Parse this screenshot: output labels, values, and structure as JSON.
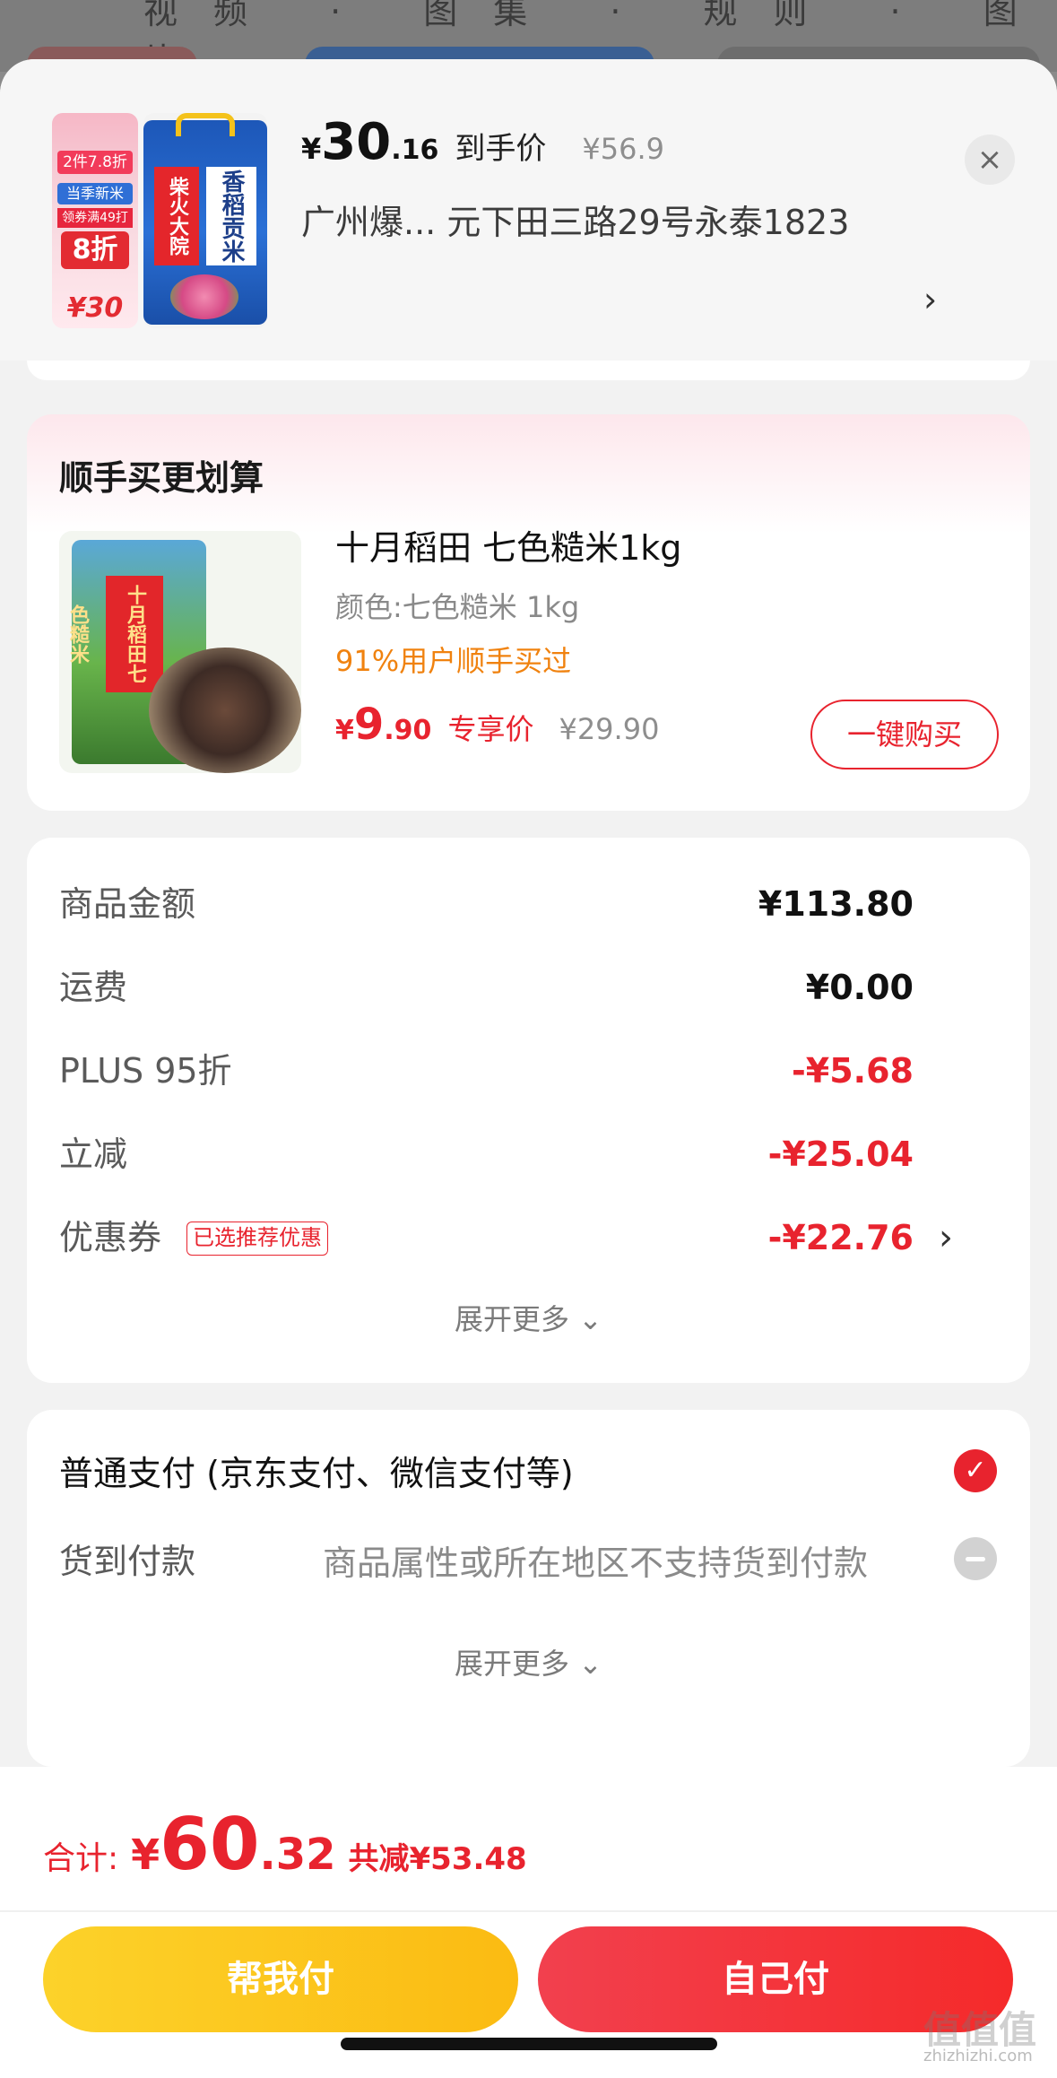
{
  "background": {
    "tabs": "视频 · 图集 · 规则 · 图片"
  },
  "header": {
    "price_yen": "¥",
    "price_int": "30",
    "price_dec": ".16",
    "price_tag": "到手价",
    "original_price": "¥56.9",
    "address": "广州爆... 元下田三路29号永泰1823",
    "arrow": "›",
    "close": "×",
    "thumb1": {
      "badge1": "2件7.8折",
      "badge2": "当季新米",
      "badge3": "领券满49打",
      "badge4": "8折",
      "price": "¥30"
    },
    "thumb2": {
      "red_label": "柴火大院",
      "white_label": "香稻贡米"
    }
  },
  "upsell": {
    "title": "顺手买更划算",
    "product_image_label": "十月稻田七色糙米",
    "name": "十月稻田 七色糙米1kg",
    "spec": "颜色:七色糙米 1kg",
    "buyers": "91%用户顺手买过",
    "price_yen": "¥",
    "price_int": "9",
    "price_dec": ".90",
    "price_tag": "专享价",
    "original_price": "¥29.90",
    "buy_button": "一键购买"
  },
  "summary": {
    "rows": [
      {
        "label": "商品金额",
        "value": "¥113.80"
      },
      {
        "label": "运费",
        "value": "¥0.00"
      },
      {
        "label": "PLUS 95折",
        "value": "-¥5.68"
      },
      {
        "label": "立减",
        "value": "-¥25.04"
      },
      {
        "label": "优惠券",
        "value": "-¥22.76",
        "badge": "已选推荐优惠",
        "chevron": "›"
      }
    ],
    "expand": "展开更多 ⌄"
  },
  "payment": {
    "normal": "普通支付 (京东支付、微信支付等)",
    "normal_check": "✓",
    "cod_label": "货到付款",
    "cod_note": "商品属性或所在地区不支持货到付款",
    "expand": "展开更多 ⌄"
  },
  "footer": {
    "total_label": "合计:",
    "total_yen": "¥",
    "total_int": "60",
    "total_dec": ".32",
    "saved": "共减¥53.48",
    "help_pay": "帮我付",
    "self_pay": "自己付"
  },
  "watermark": {
    "big": "值值值",
    "small": "zhizhizhi.com"
  },
  "colors": {
    "accent": "#e8232e",
    "help_button": "#fbbb12",
    "self_button": "#f52a2a"
  }
}
